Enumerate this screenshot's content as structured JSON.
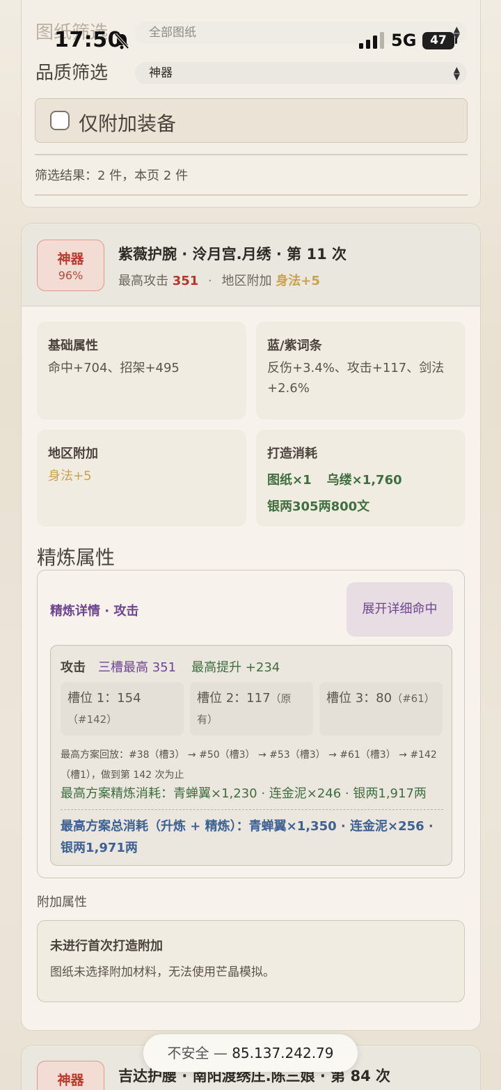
{
  "status_bar": {
    "time": "17:50",
    "network": "5G",
    "battery": "47"
  },
  "filters": {
    "blueprint_label": "图纸筛选",
    "blueprint_value": "全部图纸",
    "quality_label": "品质筛选",
    "quality_value": "神器",
    "only_extra_label": "仅附加装备",
    "result_text": "筛选结果：2 件，本页 2 件"
  },
  "item": {
    "quality_name": "神器",
    "quality_pct": "96%",
    "title": "紫薇护腕 · 泠月宫.月绣 · 第 11 次",
    "max_attack_label": "最高攻击",
    "max_attack_value": "351",
    "region_label": "地区附加",
    "region_value": "身法+5",
    "base_attr_title": "基础属性",
    "base_attr_text": "命中+704、招架+495",
    "affix_title": "蓝/紫词条",
    "affix_text": "反伤+3.4%、攻击+117、剑法+2.6%",
    "region_box_title": "地区附加",
    "region_box_text": "身法+5",
    "craft_cost_title": "打造消耗",
    "craft_cost_1": "图纸×1",
    "craft_cost_2": "乌缕×1,760",
    "craft_cost_3": "银两305两800文",
    "refine_section_title": "精炼属性",
    "refine": {
      "header": "精炼详情 · 攻击",
      "expand_label": "展开详细命中",
      "attr_name": "攻击",
      "three_slot_max": "三槽最高 351",
      "max_increase": "最高提升 +234",
      "slot1": "槽位 1：154",
      "slot1_note": "（#142）",
      "slot2": "槽位 2：117",
      "slot2_note": "（原有）",
      "slot3": "槽位 3：80",
      "slot3_note": "（#61）",
      "replay": "最高方案回放：#38（槽3） → #50（槽3） → #53（槽3） → #61（槽3） → #142（槽1），做到第 142 次为止",
      "refine_cost": "最高方案精炼消耗：青蝉翼×1,230 · 连金泥×246 · 银两1,917两",
      "total_cost": "最高方案总消耗（升炼 + 精炼）：青蝉翼×1,350 · 连金泥×256 · 银两1,971两"
    },
    "extra_section_title": "附加属性",
    "extra_head": "未进行首次打造附加",
    "extra_desc": "图纸未选择附加材料，无法使用芒晶模拟。"
  },
  "next_item": {
    "quality_name": "神器",
    "title": "吉达护腰 · 南阳渡绣庄.陈三娘 · 第 84 次"
  },
  "url_bar": {
    "insecure": "不安全",
    "host": "85.137.242.79"
  }
}
